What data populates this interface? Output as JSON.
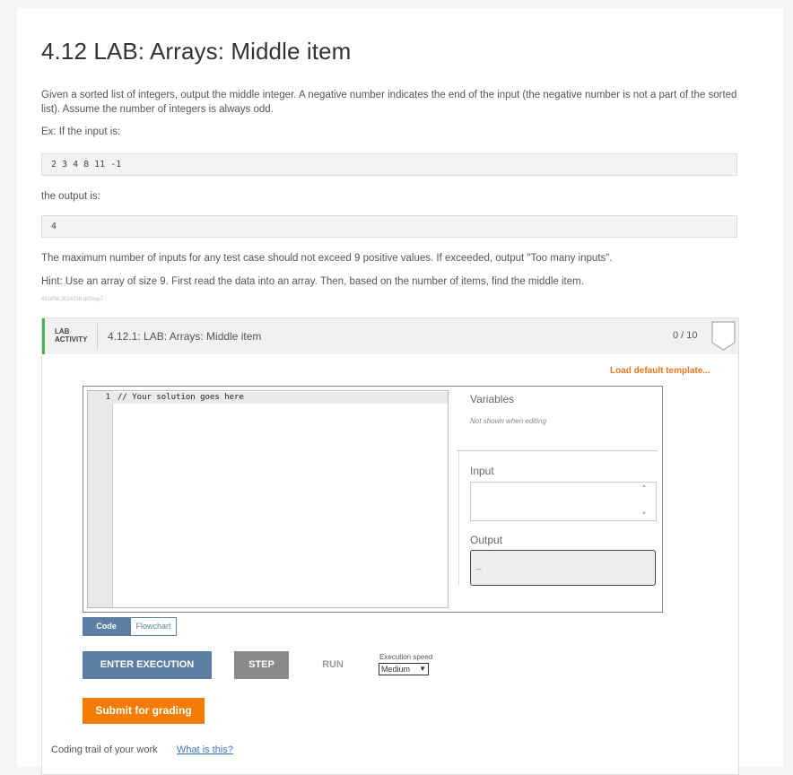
{
  "title": "4.12 LAB: Arrays: Middle item",
  "description": "Given a sorted list of integers, output the middle integer. A negative number indicates the end of the input (the negative number is not a part of the sorted list). Assume the number of integers is always odd.",
  "example_intro": "Ex: If the input is:",
  "example_input": "2 3 4 8 11 -1",
  "output_intro": "the output is:",
  "example_output": "4",
  "max_note": "The maximum number of inputs for any test case should not exceed 9 positive values. If exceeded, output \"Too many inputs\".",
  "hint": "Hint: Use an array of size 9. First read the data into an array. Then, based on the number of items, find the middle item.",
  "tracking_id": "491858.3024256.qx3zqy7",
  "lab": {
    "tag_line1": "LAB",
    "tag_line2": "ACTIVITY",
    "name": "4.12.1: LAB: Arrays: Middle item",
    "score": "0 / 10",
    "load_template": "Load default template..."
  },
  "editor": {
    "line_number": "1",
    "code": "// Your solution goes here"
  },
  "panel": {
    "variables_label": "Variables",
    "variables_note": "Not shown when editing",
    "input_label": "Input",
    "input_value": "",
    "output_label": "Output",
    "output_cursor": "_"
  },
  "tabs": {
    "code": "Code",
    "flowchart": "Flowchart"
  },
  "controls": {
    "enter_execution": "ENTER EXECUTION",
    "step": "STEP",
    "run": "RUN",
    "speed_label": "Execution speed",
    "speed_value": "Medium"
  },
  "submit": "Submit for grading",
  "footer": {
    "trail": "Coding trail of your work",
    "what_is_this": "What is this?"
  },
  "colors": {
    "accent_blue": "#5d7fa3",
    "orange": "#f57c00",
    "green": "#4caf50"
  }
}
